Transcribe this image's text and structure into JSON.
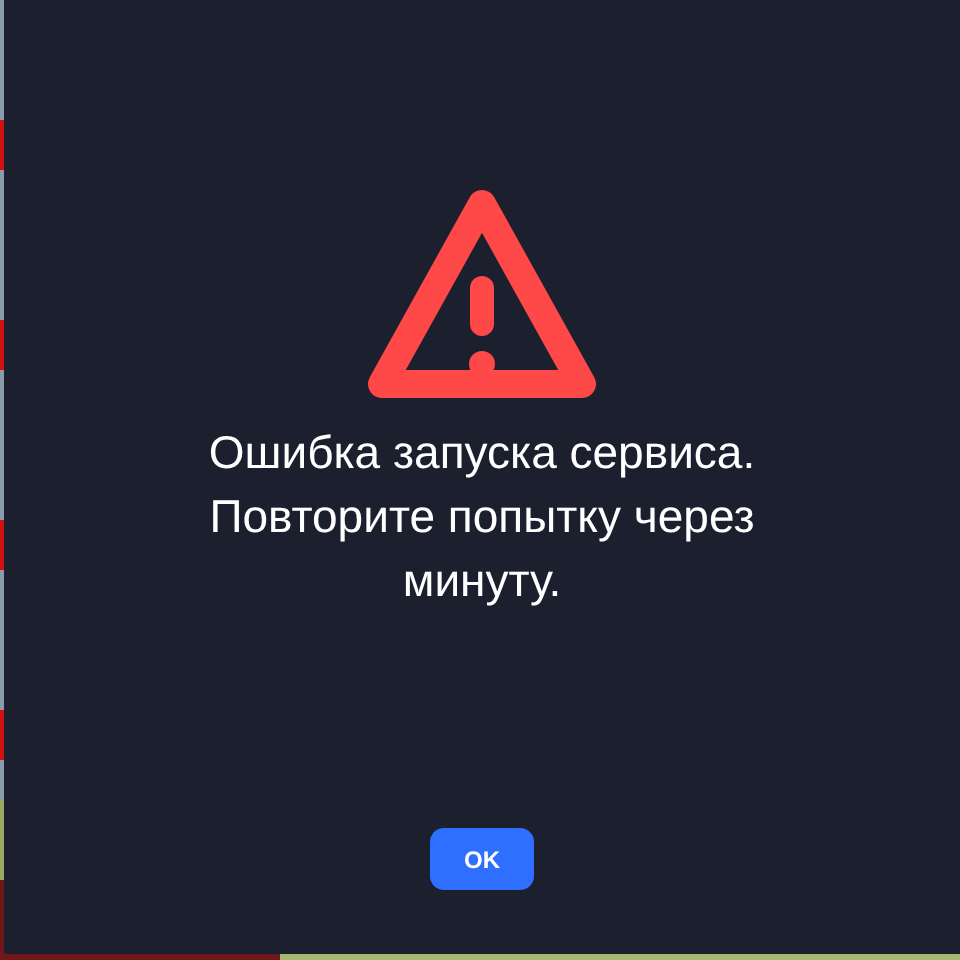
{
  "dialog": {
    "message": "Ошибка запуска сервиса. Повторите попытку через минуту.",
    "button": "OK"
  }
}
